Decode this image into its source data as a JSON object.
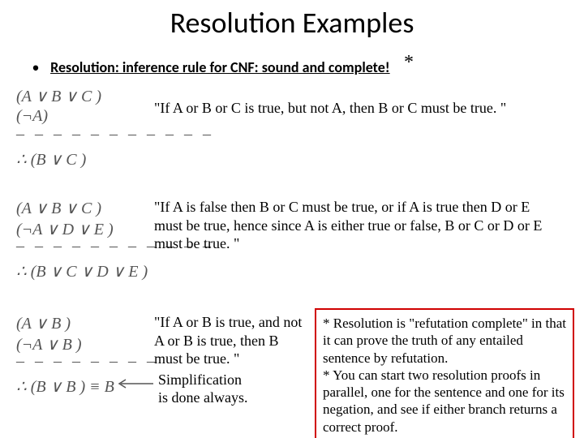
{
  "title": "Resolution Examples",
  "bullet_text": "Resolution: inference rule for CNF: sound and complete!",
  "bullet_asterisk": "*",
  "derivations": {
    "d1": {
      "l1": "(A ∨ B ∨ C )",
      "l2": "(¬A)",
      "c": "∴ (B ∨ C )"
    },
    "d2": {
      "l1": "(A ∨ B ∨ C )",
      "l2": "(¬A ∨ D ∨ E )",
      "c": "∴ (B ∨ C ∨ D ∨ E )"
    },
    "d3": {
      "l1": "(A ∨ B )",
      "l2": "(¬A ∨ B )",
      "c": "∴ (B ∨ B ) ≡ B"
    }
  },
  "quotes": {
    "q1": "\"If A or B or C is true, but not A, then B or C must be true. \"",
    "q2": "\"If A is false then B or C must be true, or if A is true then D or E must be true, hence since A is either true or false, B or C or D or E must be true. \"",
    "q3": "\"If A or B is true, and not A or B is true, then B must be true. \""
  },
  "simplification": "Simplification\nis done always.",
  "redbox_lines": [
    "* Resolution is \"refutation complete\" in that it can prove the truth of any entailed sentence by refutation.",
    "* You can start two resolution proofs in parallel, one for the sentence and one for its negation, and see if either branch returns a correct proof."
  ],
  "dashes_short": "– – – – – – – –",
  "dashes_long": "– – – – – – – – – – –"
}
